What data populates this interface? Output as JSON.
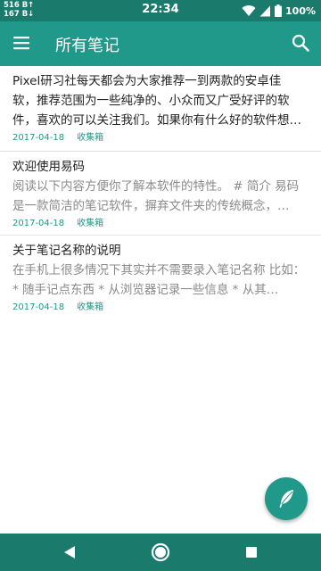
{
  "status_bar": {
    "net_up": "516 B↑",
    "net_down": "167 B↓",
    "time": "22:34",
    "battery": "100%"
  },
  "app_bar": {
    "title": "所有笔记",
    "menu_icon": "hamburger-menu-icon",
    "search_icon": "search-icon"
  },
  "notes": [
    {
      "title": "Pixel研习社每天都会为大家推荐一到两款的安卓佳",
      "body": "软，推荐范围为一些纯净的、小众而又广受好评的软件，喜欢的可以关注我们。如果你有什么好的软件想…",
      "date": "2017-04-18",
      "folder": "收集箱"
    },
    {
      "title": "欢迎使用易码",
      "body": "阅读以下内容方便你了解本软件的特性。 # 简介 易码是一款简洁的笔记软件，摒弃文件夹的传统概念，…",
      "date": "2017-04-18",
      "folder": "收集箱"
    },
    {
      "title": "关于笔记名称的说明",
      "body": "在手机上很多情况下其实并不需要录入笔记名称 比如： * 随手记点东西 * 从浏览器记录一些信息 * 从其…",
      "date": "2017-04-18",
      "folder": "收集箱"
    }
  ],
  "fab": {
    "icon": "feather-quill-icon"
  },
  "nav_bar": {
    "back_icon": "back-triangle-icon",
    "home_icon": "home-circle-icon",
    "recents_icon": "recents-square-icon"
  },
  "colors": {
    "primary": "#20998a",
    "primary_dark": "#1a7a6c",
    "accent_text": "#20998a"
  }
}
